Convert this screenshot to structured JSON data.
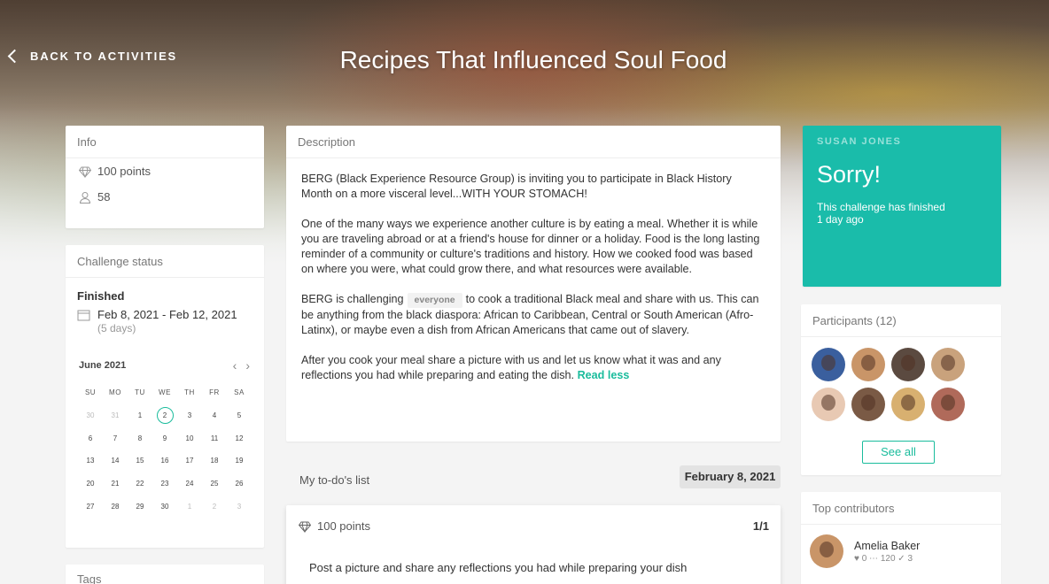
{
  "nav": {
    "back_label": "BACK TO ACTIVITIES",
    "page_title": "Recipes That Influenced Soul Food"
  },
  "info": {
    "header": "Info",
    "points": "100 points",
    "participants_count": "58"
  },
  "status": {
    "header": "Challenge status",
    "state": "Finished",
    "date_range": "Feb 8, 2021 - Feb 12, 2021",
    "duration": "(5 days)"
  },
  "calendar": {
    "month": "June 2021",
    "weekdays": [
      "SU",
      "MO",
      "TU",
      "WE",
      "TH",
      "FR",
      "SA"
    ],
    "days": [
      "30",
      "31",
      "1",
      "2",
      "3",
      "4",
      "5",
      "6",
      "7",
      "8",
      "9",
      "10",
      "11",
      "12",
      "13",
      "14",
      "15",
      "16",
      "17",
      "18",
      "19",
      "20",
      "21",
      "22",
      "23",
      "24",
      "25",
      "26",
      "27",
      "28",
      "29",
      "30",
      "1",
      "2",
      "3"
    ],
    "muted_indices": [
      0,
      1,
      32,
      33,
      34
    ],
    "today_index": 3
  },
  "tags": {
    "header": "Tags"
  },
  "description": {
    "header": "Description",
    "p1": "BERG (Black Experience Resource Group) is inviting you to participate in Black History Month on a more visceral level...WITH YOUR STOMACH!",
    "p2": "One of the many ways we experience another culture is by eating a meal. Whether it is while you are traveling abroad or at a friend's house for dinner or a holiday. Food is the long lasting reminder of a community or culture's traditions and history. How we cooked food was based on where you were, what could grow there, and what resources were available.",
    "p3_before": "BERG is challenging",
    "p3_pill": "everyone",
    "p3_after": "to cook a traditional Black meal and share with us. This can be anything from the black diaspora: African to Caribbean, Central or South American (Afro-Latinx), or maybe even a dish from African Americans that came out of slavery.",
    "p4": "After you cook your meal share a picture with us and let us know what it was and any reflections you had while preparing and eating the dish.",
    "read_less": "Read less"
  },
  "todos": {
    "label": "My to-do's list",
    "date": "February 8, 2021",
    "item_points": "100 points",
    "item_count": "1/1",
    "item_text": "Post a picture and share any reflections you had while preparing your dish"
  },
  "sorry": {
    "name": "SUSAN JONES",
    "heading": "Sorry!",
    "line1": "This challenge has finished",
    "line2": "1 day ago"
  },
  "participants": {
    "header": "Participants (12)",
    "see_all": "See all",
    "avatar_colors": [
      "#3a5f9e",
      "#c99568",
      "#5b4a40",
      "#c9a27c",
      "#e8c9b3",
      "#7a5a45",
      "#d8b070",
      "#b06a5a"
    ]
  },
  "contributors": {
    "header": "Top contributors",
    "top": {
      "name": "Amelia Baker",
      "stats": "♥ 0  ⋯ 120  ✓ 3"
    }
  },
  "colors": {
    "accent": "#1abc9c",
    "sorry_bg": "#1abcaa"
  }
}
